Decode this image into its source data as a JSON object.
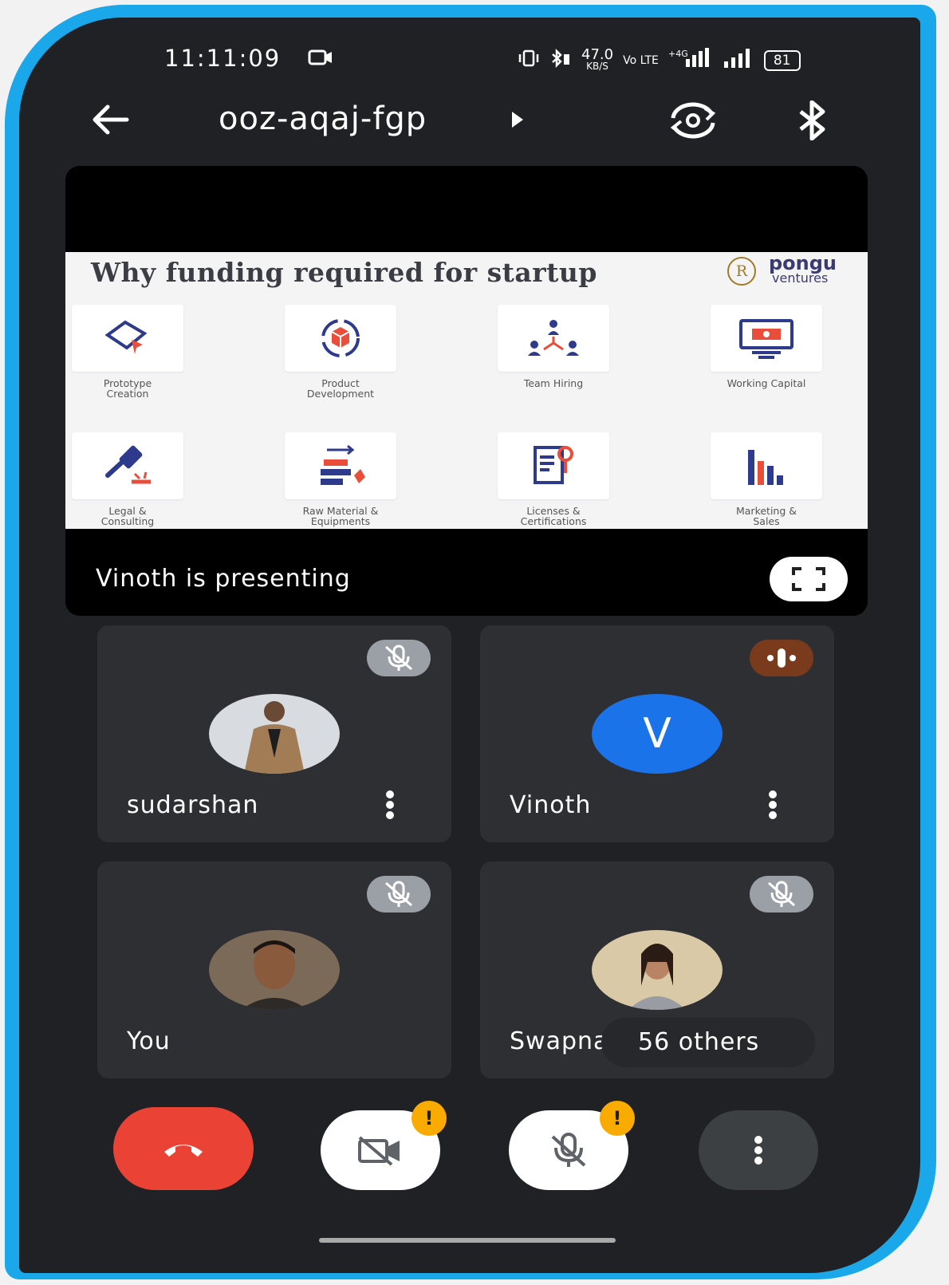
{
  "status_bar": {
    "time": "11:11:09",
    "net_speed": "47.0",
    "net_speed_unit": "KB/S",
    "volte": "Vo LTE",
    "network": "4G",
    "battery": "81"
  },
  "header": {
    "meeting_code": "ooz-aqaj-fgp"
  },
  "presentation": {
    "slide": {
      "title": "Why funding required for startup",
      "logo_mark": "R",
      "logo_name": "pongu",
      "logo_sub": "ventures",
      "items": [
        {
          "label": "Prototype\nCreation",
          "icon": "prototype-icon"
        },
        {
          "label": "Product\nDevelopment",
          "icon": "product-box-icon"
        },
        {
          "label": "Team Hiring",
          "icon": "team-icon"
        },
        {
          "label": "Working Capital",
          "icon": "monitor-cash-icon"
        },
        {
          "label": "Legal &\nConsulting",
          "icon": "gavel-icon"
        },
        {
          "label": "Raw Material &\nEquipments",
          "icon": "materials-icon"
        },
        {
          "label": "Licenses &\nCertifications",
          "icon": "certificate-icon"
        },
        {
          "label": "Marketing &\nSales",
          "icon": "bar-chart-icon"
        }
      ]
    },
    "presenter_label": "Vinoth is presenting"
  },
  "participants": [
    {
      "name": "sudarshan",
      "mic": "muted",
      "avatar": "photo"
    },
    {
      "name": "Vinoth",
      "mic": "speaking",
      "avatar": "letter",
      "initial": "V",
      "color": "#1a73e8"
    },
    {
      "name": "You",
      "mic": "muted",
      "avatar": "photo"
    },
    {
      "name": "Swapna",
      "mic": "muted",
      "avatar": "photo"
    }
  ],
  "others_count": "56 others",
  "controls": {
    "end_call_color": "#ea4335",
    "camera_warning": "!",
    "mic_warning": "!"
  },
  "colors": {
    "background": "#202124",
    "frame": "#1ba8ea",
    "tile": "#2e2f33"
  }
}
